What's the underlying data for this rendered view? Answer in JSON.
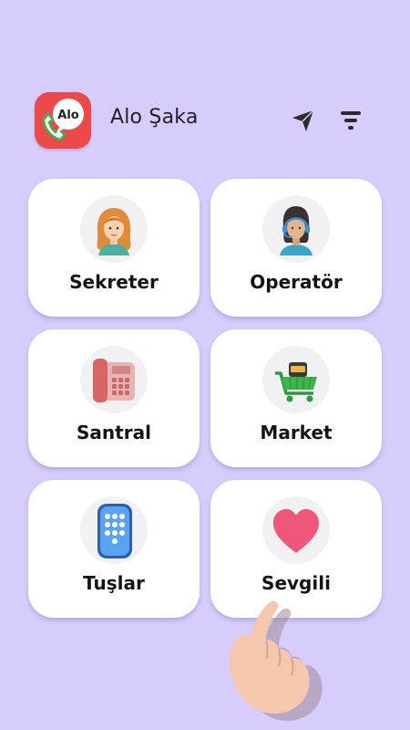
{
  "header": {
    "logo_text": "Alo",
    "app_title": "Alo Şaka",
    "send_icon": "send-icon",
    "filter_icon": "filter-icon"
  },
  "cards": [
    {
      "label": "Sekreter",
      "icon": "secretary-woman-icon"
    },
    {
      "label": "Operatör",
      "icon": "operator-headset-icon"
    },
    {
      "label": "Santral",
      "icon": "desk-phone-icon"
    },
    {
      "label": "Market",
      "icon": "shopping-cart-icon"
    },
    {
      "label": "Tuşlar",
      "icon": "keypad-phone-icon"
    },
    {
      "label": "Sevgili",
      "icon": "heart-icon"
    }
  ],
  "colors": {
    "background": "#d7ccfb",
    "card": "#ffffff",
    "logo": "#ea4a4a",
    "heart": "#f0557a"
  }
}
